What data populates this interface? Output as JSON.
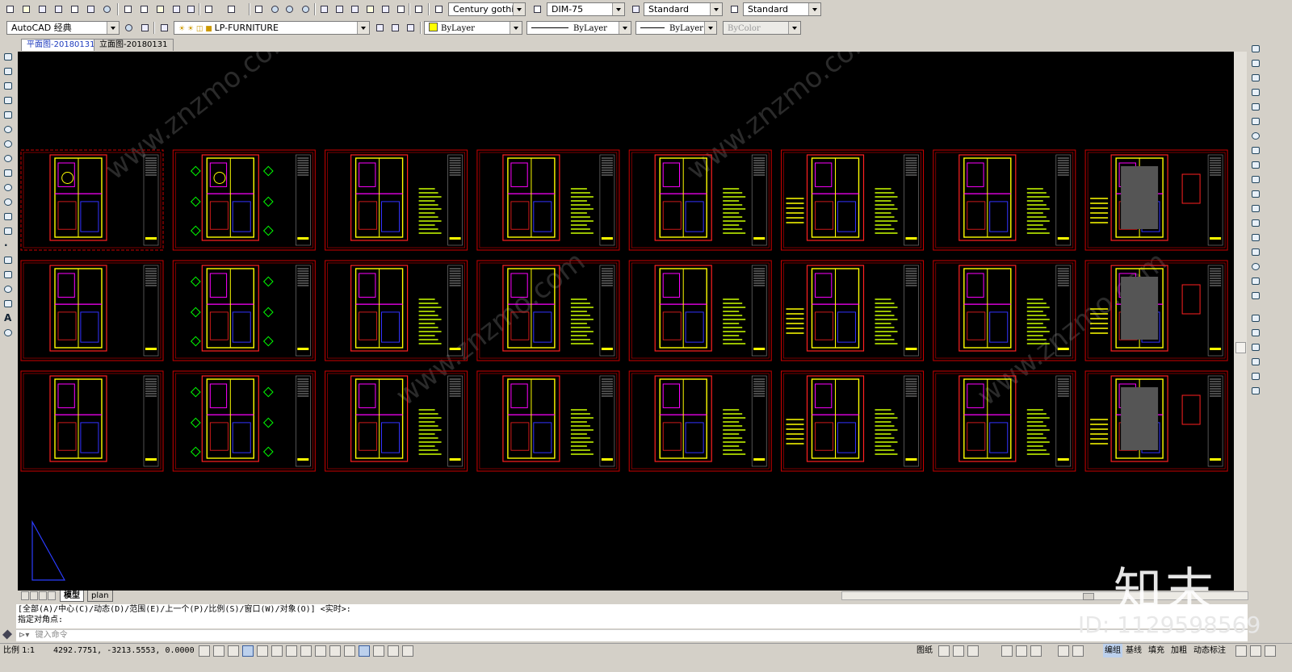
{
  "toolbar": {
    "text_style": "Century gothic",
    "dim_style": "DIM-75",
    "table_style": "Standard",
    "mleader_style": "Standard"
  },
  "layers": {
    "workspace": "AutoCAD 经典",
    "current_layer": "LP-FURNITURE",
    "color": "ByLayer",
    "linetype": "ByLayer",
    "lineweight": "ByLayer",
    "plot_style": "ByColor"
  },
  "doc_tabs": [
    "平面图-20180131",
    "立面图-20180131"
  ],
  "layout_tabs": [
    "模型",
    "plan"
  ],
  "command": {
    "history_line1": "[全部(A)/中心(C)/动态(D)/范围(E)/上一个(P)/比例(S)/窗口(W)/对象(O)] <实时>:",
    "history_line2": "指定对角点:",
    "input_placeholder": "键入命令"
  },
  "status": {
    "scale_label": "比例 1:1",
    "coordinates": "4292.7751, -3213.5553, 0.0000",
    "right_labels": [
      "图纸",
      "编组",
      "基线",
      "填充",
      "加粗",
      "动态标注"
    ]
  },
  "watermark": {
    "logo": "知末",
    "id": "ID: 1129598569",
    "site": "www.znzmo.com"
  },
  "colors": {
    "canvas": "#000000",
    "sheet_border": "#cc0000",
    "plan_red": "#ff2020",
    "plan_yellow": "#ffff00",
    "plan_magenta": "#ff00ff",
    "plan_blue": "#3333ff",
    "annotation_green": "#ccff00"
  },
  "drawing": {
    "rows": 3,
    "columns": 8,
    "sheet_count": 24
  }
}
